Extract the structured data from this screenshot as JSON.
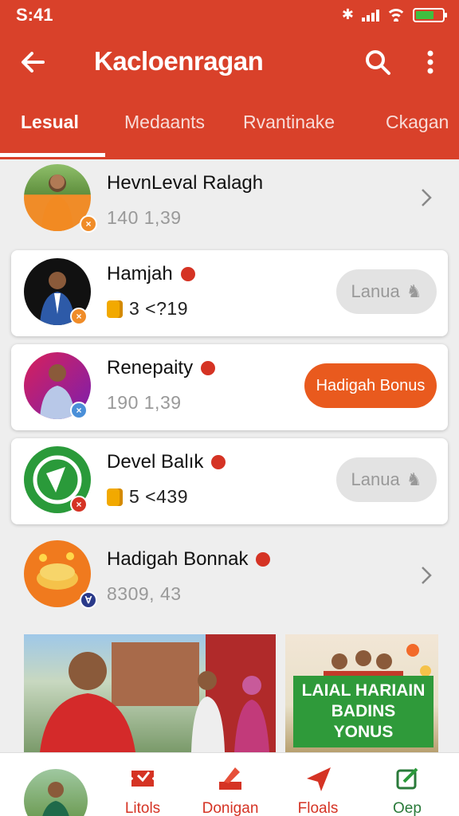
{
  "status_bar": {
    "time": "S:41"
  },
  "app_bar": {
    "title": "Kacloenragan",
    "back_icon": "back-arrow-icon",
    "search_icon": "search-icon",
    "more_icon": "more-vert-icon"
  },
  "tabs": [
    {
      "label": "Lesual",
      "active": true
    },
    {
      "label": "Medaants",
      "active": false
    },
    {
      "label": "Rvantinake",
      "active": false
    },
    {
      "label": "Ckagan",
      "active": false
    }
  ],
  "rows": [
    {
      "name": "HevnLeval Ralagh",
      "sub": "140 1,39",
      "action": "chevron"
    },
    {
      "name": "Hamjah",
      "sub": "3 <?19",
      "action_label": "Lanua"
    },
    {
      "name": "Renepaity",
      "sub": "190 1,39",
      "action_label": "Hadigah Bonus"
    },
    {
      "name": "Devel Balık",
      "sub": "5 <439",
      "action_label": "Lanua"
    },
    {
      "name": "Hadigah Bonnak",
      "sub": "8309, 43",
      "action": "chevron"
    }
  ],
  "promo": {
    "caption_line1": "LAIAL HARIAIN",
    "caption_line2": "BADINS YONUS"
  },
  "bottom_nav": [
    {
      "label": "Litols",
      "icon": "ticket-icon"
    },
    {
      "label": "Donigan",
      "icon": "pencil-icon"
    },
    {
      "label": "Floals",
      "icon": "paper-plane-icon"
    },
    {
      "label": "Oep",
      "icon": "edit-square-icon"
    }
  ],
  "colors": {
    "brand": "#d9412a",
    "accent_orange": "#e95a1e",
    "promo_green": "#2f9a3a"
  }
}
